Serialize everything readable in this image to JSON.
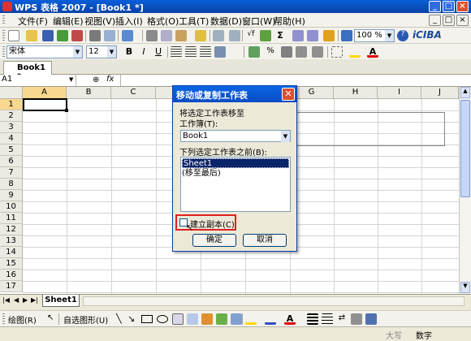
{
  "window": {
    "title": "WPS 表格 2007 - [Book1 *]"
  },
  "menu": [
    "文件(F)",
    "编辑(E)",
    "视图(V)",
    "插入(I)",
    "格式(O)",
    "工具(T)",
    "数据(D)",
    "窗口(W)",
    "帮助(H)"
  ],
  "toolbar": {
    "zoom": "100 %",
    "brand": "iCIBA"
  },
  "format": {
    "font": "宋体",
    "size": "12",
    "bold": "B",
    "italic": "I",
    "underline": "U"
  },
  "workbook_tab": "Book1 *",
  "formula": {
    "cell_ref": "A1",
    "fx": "fx"
  },
  "columns": [
    "A",
    "B",
    "C",
    "D",
    "E",
    "F",
    "G",
    "H",
    "I",
    "J"
  ],
  "rows": [
    "1",
    "2",
    "3",
    "4",
    "5",
    "6",
    "7",
    "8",
    "9",
    "10",
    "11",
    "12",
    "13",
    "14",
    "15",
    "16",
    "17"
  ],
  "sheet_tab": "Sheet1",
  "drawing": {
    "draw_label": "绘图(R)",
    "autoshape_label": "自选图形(U)"
  },
  "status": {
    "caps": "大写",
    "num": "数字"
  },
  "dialog": {
    "title": "移动或复制工作表",
    "move_to_label": "将选定工作表移至",
    "workbook_label": "工作簿(T):",
    "workbook_value": "Book1",
    "before_label": "下列选定工作表之前(B):",
    "list": [
      "Sheet1",
      "(移至最后)"
    ],
    "copy_label": "建立副本(C)",
    "copy_checked": false,
    "ok": "确定",
    "cancel": "取消"
  }
}
